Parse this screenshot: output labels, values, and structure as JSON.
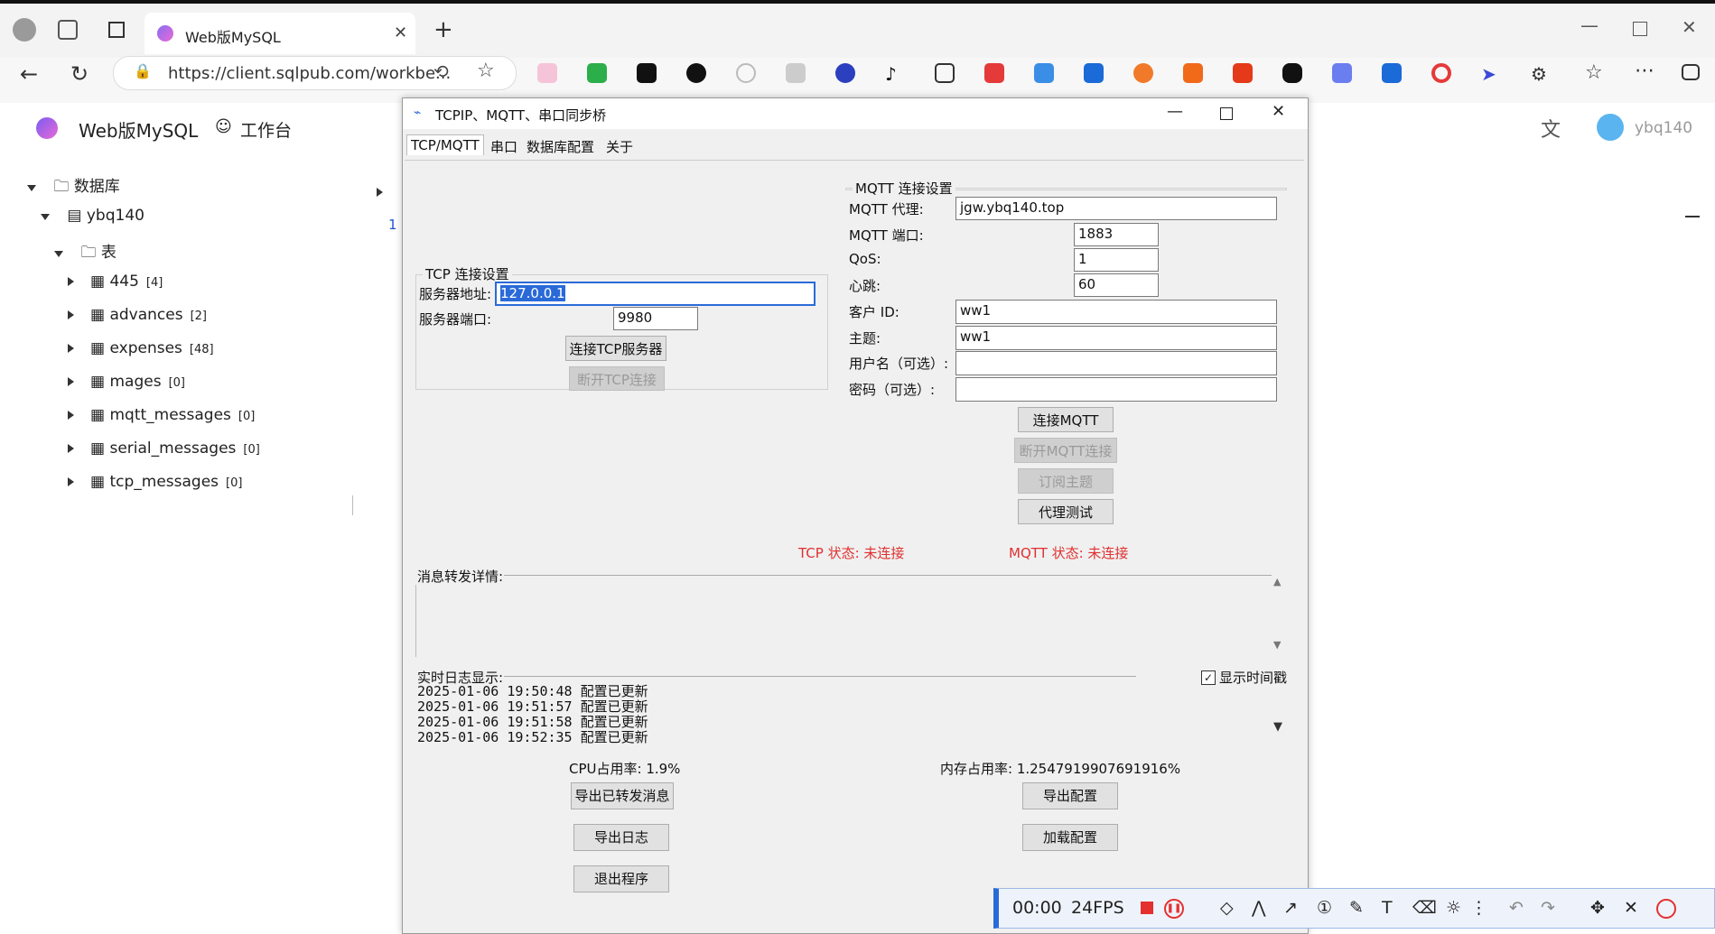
{
  "browser": {
    "tab_title": "Web版MySQL",
    "url": "https://client.sqlpub.com/workbe...",
    "profile": "ybq140"
  },
  "page": {
    "brand": "Web版MySQL",
    "workbench": "工作台",
    "user": "ybq140",
    "tree": {
      "root": "数据库",
      "db": "ybq140",
      "tables_folder": "表",
      "tables": [
        {
          "name": "445",
          "count": "[4]"
        },
        {
          "name": "advances",
          "count": "[2]"
        },
        {
          "name": "expenses",
          "count": "[48]"
        },
        {
          "name": "mages",
          "count": "[0]"
        },
        {
          "name": "mqtt_messages",
          "count": "[0]"
        },
        {
          "name": "serial_messages",
          "count": "[0]"
        },
        {
          "name": "tcp_messages",
          "count": "[0]"
        }
      ]
    },
    "line_number": "1"
  },
  "app": {
    "title": "TCPIP、MQTT、串口同步桥",
    "tabs": [
      "TCP/MQTT",
      "串口",
      "数据库配置",
      "关于"
    ],
    "tcp": {
      "group_title": "TCP 连接设置",
      "server_addr_label": "服务器地址:",
      "server_addr": "127.0.0.1",
      "server_port_label": "服务器端口:",
      "server_port": "9980",
      "connect_btn": "连接TCP服务器",
      "disconnect_btn": "断开TCP连接"
    },
    "mqtt": {
      "group_title": "MQTT 连接设置",
      "broker_label": "MQTT 代理:",
      "broker": "jgw.ybq140.top",
      "port_label": "MQTT 端口:",
      "port": "1883",
      "qos_label": "QoS:",
      "qos": "1",
      "heartbeat_label": "心跳:",
      "heartbeat": "60",
      "client_id_label": "客户 ID:",
      "client_id": "ww1",
      "topic_label": "主题:",
      "topic": "ww1",
      "username_label": "用户名（可选）:",
      "password_label": "密码（可选）:",
      "connect_btn": "连接MQTT",
      "disconnect_btn": "断开MQTT连接",
      "subscribe_btn": "订阅主题",
      "proxy_test_btn": "代理测试"
    },
    "tcp_status": "TCP 状态: 未连接",
    "mqtt_status": "MQTT 状态: 未连接",
    "forward_label": "消息转发详情:",
    "log_label": "实时日志显示:",
    "show_timestamp": "显示时间戳",
    "log_lines": [
      "2025-01-06 19:50:48 配置已更新",
      "2025-01-06 19:51:57 配置已更新",
      "2025-01-06 19:51:58 配置已更新",
      "2025-01-06 19:52:35 配置已更新"
    ],
    "cpu": "CPU占用率: 1.9%",
    "mem": "内存占用率: 1.2547919907691916%",
    "export_msgs_btn": "导出已转发消息",
    "export_log_btn": "导出日志",
    "exit_btn": "退出程序",
    "export_cfg_btn": "导出配置",
    "load_cfg_btn": "加载配置"
  },
  "recorder": {
    "time": "00:00",
    "fps": "24FPS"
  }
}
